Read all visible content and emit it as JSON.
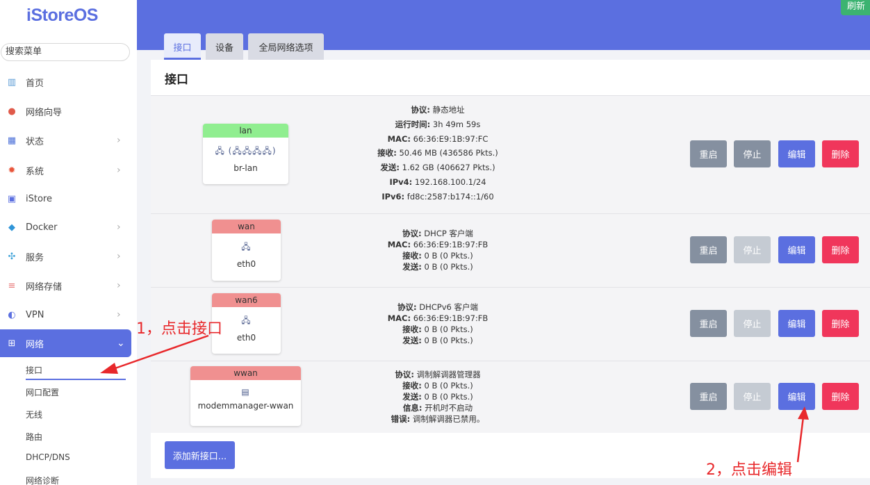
{
  "sidebar": {
    "logo": "iStoreOS",
    "search_placeholder": "搜索菜单",
    "items": [
      {
        "label": "首页",
        "icon": "dashboard-icon",
        "chevron": false
      },
      {
        "label": "网络向导",
        "icon": "location-icon",
        "chevron": false
      },
      {
        "label": "状态",
        "icon": "grid-icon",
        "chevron": true
      },
      {
        "label": "系统",
        "icon": "gear-icon",
        "chevron": true
      },
      {
        "label": "iStore",
        "icon": "store-icon",
        "chevron": false
      },
      {
        "label": "Docker",
        "icon": "docker-icon",
        "chevron": true
      },
      {
        "label": "服务",
        "icon": "services-icon",
        "chevron": true
      },
      {
        "label": "网络存储",
        "icon": "storage-icon",
        "chevron": true
      },
      {
        "label": "VPN",
        "icon": "vpn-icon",
        "chevron": true
      },
      {
        "label": "网络",
        "icon": "network-icon",
        "chevron": true,
        "active": true
      }
    ],
    "sub_items": [
      "接口",
      "网口配置",
      "无线",
      "路由",
      "DHCP/DNS",
      "网络诊断"
    ]
  },
  "header": {
    "refresh_label": "刷新",
    "tabs": [
      "接口",
      "设备",
      "全局网络选项"
    ]
  },
  "main": {
    "title": "接口",
    "add_button": "添加新接口...",
    "buttons": {
      "restart": "重启",
      "stop": "停止",
      "edit": "编辑",
      "delete": "删除"
    },
    "interfaces": [
      {
        "name": "lan",
        "header_color": "#90ee90",
        "device": "br-lan",
        "icons": "🖧 (🖧🖧🖧🖧)",
        "info": [
          {
            "k": "协议:",
            "v": " 静态地址"
          },
          {
            "k": "运行时间:",
            "v": " 3h 49m 59s"
          },
          {
            "k": "MAC:",
            "v": " 66:36:E9:1B:97:FC"
          },
          {
            "k": "接收:",
            "v": " 50.46 MB (436586 Pkts.)"
          },
          {
            "k": "发送:",
            "v": " 1.62 GB (406627 Pkts.)"
          },
          {
            "k": "IPv4:",
            "v": " 192.168.100.1/24"
          },
          {
            "k": "IPv6:",
            "v": " fd8c:2587:b174::1/60"
          }
        ],
        "stop_enabled": true
      },
      {
        "name": "wan",
        "header_color": "#f09090",
        "device": "eth0",
        "icons": "🖧",
        "info": [
          {
            "k": "协议:",
            "v": " DHCP 客户端"
          },
          {
            "k": "MAC:",
            "v": " 66:36:E9:1B:97:FB"
          },
          {
            "k": "接收:",
            "v": " 0 B (0 Pkts.)"
          },
          {
            "k": "发送:",
            "v": " 0 B (0 Pkts.)"
          }
        ],
        "stop_enabled": false
      },
      {
        "name": "wan6",
        "header_color": "#f09090",
        "device": "eth0",
        "icons": "🖧",
        "info": [
          {
            "k": "协议:",
            "v": " DHCPv6 客户端"
          },
          {
            "k": "MAC:",
            "v": " 66:36:E9:1B:97:FB"
          },
          {
            "k": "接收:",
            "v": " 0 B (0 Pkts.)"
          },
          {
            "k": "发送:",
            "v": " 0 B (0 Pkts.)"
          }
        ],
        "stop_enabled": false
      },
      {
        "name": "wwan",
        "header_color": "#f09090",
        "device": "modemmanager-wwan",
        "icons": "▤",
        "info": [
          {
            "k": "协议:",
            "v": " 调制解调器管理器"
          },
          {
            "k": "接收:",
            "v": " 0 B (0 Pkts.)"
          },
          {
            "k": "发送:",
            "v": " 0 B (0 Pkts.)"
          },
          {
            "k": "信息:",
            "v": " 开机时不启动"
          },
          {
            "k": "错误:",
            "v": " 调制解调器已禁用。"
          }
        ],
        "stop_enabled": false
      }
    ]
  },
  "annotations": {
    "step1": "1，点击接口",
    "step2": "2，点击编辑",
    "color": "#e8282b"
  }
}
